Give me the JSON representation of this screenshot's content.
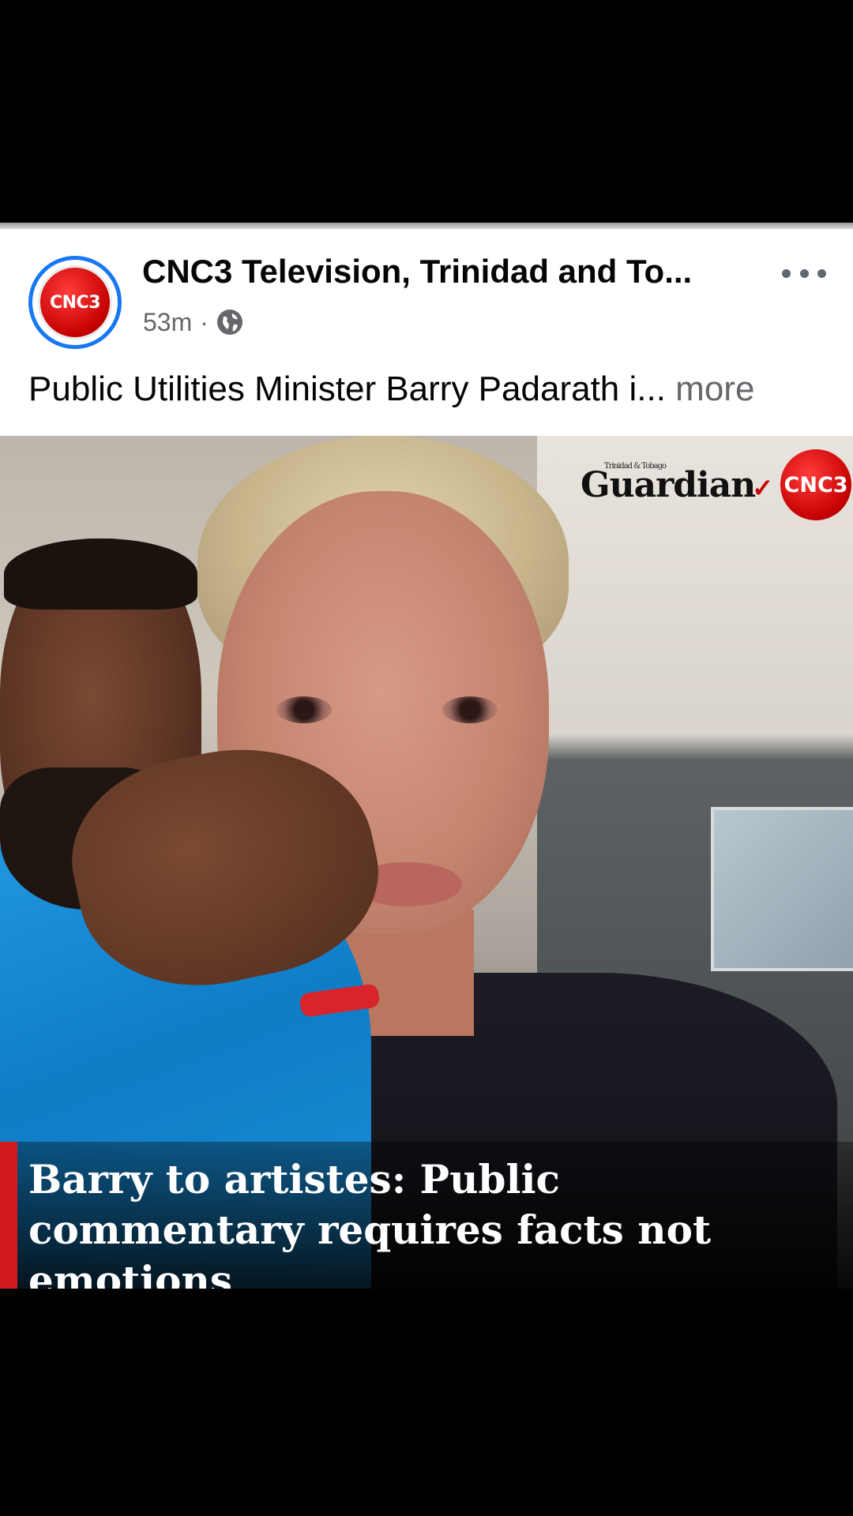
{
  "post": {
    "page_name": "CNC3 Television, Trinidad and To...",
    "avatar_text": "CNC3",
    "timestamp": "53m",
    "separator": "·",
    "privacy_icon": "globe-icon",
    "caption": "Public Utilities Minister Barry Padarath i...",
    "caption_more": "more",
    "options_icon": "more-options-icon"
  },
  "image": {
    "logo_guardian_small": "Trinidad & Tobago",
    "logo_guardian": "Guardian",
    "logo_cnc3": "CNC3",
    "headline": "Barry to artistes: Public commentary requires facts not emotions"
  },
  "colors": {
    "accent_blue": "#1877f2",
    "brand_red": "#d41a1f",
    "text_primary": "#050505",
    "text_secondary": "#65676b"
  }
}
